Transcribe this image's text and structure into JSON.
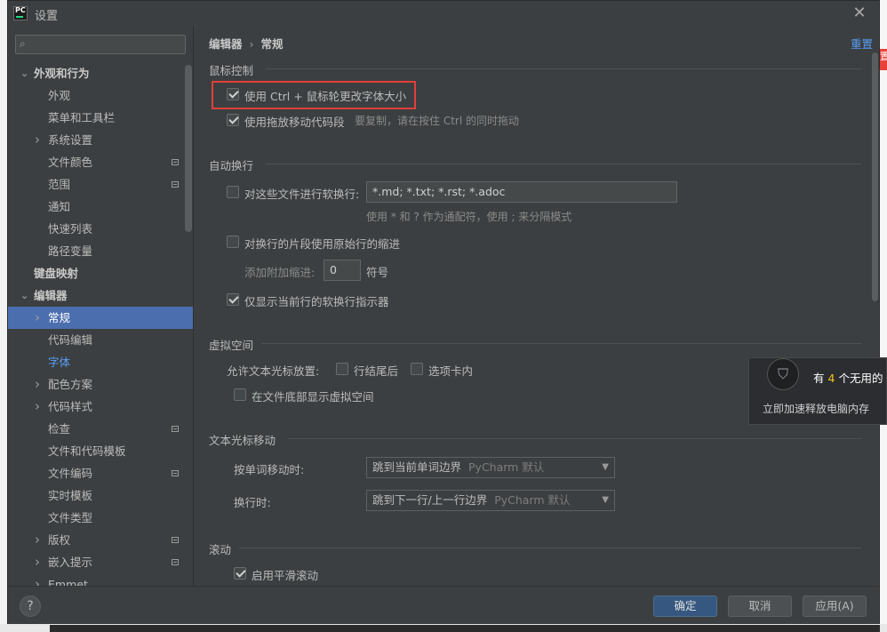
{
  "window": {
    "title": "设置",
    "app_icon": "PC"
  },
  "search": {
    "placeholder": ""
  },
  "sidebar": {
    "items": [
      {
        "label": "外观和行为",
        "level": 0,
        "bold": true,
        "arrow": "down"
      },
      {
        "label": "外观",
        "level": 1
      },
      {
        "label": "菜单和工具栏",
        "level": 1
      },
      {
        "label": "系统设置",
        "level": 1,
        "arrow": "right"
      },
      {
        "label": "文件颜色",
        "level": 1,
        "badge": true
      },
      {
        "label": "范围",
        "level": 1,
        "badge": true
      },
      {
        "label": "通知",
        "level": 1
      },
      {
        "label": "快速列表",
        "level": 1
      },
      {
        "label": "路径变量",
        "level": 1
      },
      {
        "label": "键盘映射",
        "level": 0,
        "bold": true
      },
      {
        "label": "编辑器",
        "level": 0,
        "bold": true,
        "arrow": "down"
      },
      {
        "label": "常规",
        "level": 1,
        "arrow": "right",
        "selected": true
      },
      {
        "label": "代码编辑",
        "level": 1
      },
      {
        "label": "字体",
        "level": 1,
        "link": true
      },
      {
        "label": "配色方案",
        "level": 1,
        "arrow": "right"
      },
      {
        "label": "代码样式",
        "level": 1,
        "arrow": "right"
      },
      {
        "label": "检查",
        "level": 1,
        "badge": true
      },
      {
        "label": "文件和代码模板",
        "level": 1
      },
      {
        "label": "文件编码",
        "level": 1,
        "badge": true
      },
      {
        "label": "实时模板",
        "level": 1
      },
      {
        "label": "文件类型",
        "level": 1
      },
      {
        "label": "版权",
        "level": 1,
        "arrow": "right",
        "badge": true
      },
      {
        "label": "嵌入提示",
        "level": 1,
        "arrow": "right",
        "badge": true
      },
      {
        "label": "Emmet",
        "level": 1,
        "arrow": "right"
      }
    ]
  },
  "breadcrumb": {
    "parent": "编辑器",
    "separator": "›",
    "current": "常规"
  },
  "reset_label": "重置",
  "sections": {
    "mouse": {
      "title": "鼠标控制",
      "ctrl_wheel_label": "使用 Ctrl + 鼠标轮更改字体大小",
      "ctrl_wheel_checked": true,
      "dnd_label": "使用拖放移动代码段",
      "dnd_checked": true,
      "dnd_hint": "要复制，请在按住 Ctrl 的同时拖动"
    },
    "softwrap": {
      "title": "自动换行",
      "files_label": "对这些文件进行软换行:",
      "files_checked": false,
      "files_value": "*.md; *.txt; *.rst; *.adoc",
      "files_hint": "使用 * 和 ? 作为通配符，使用 ; 来分隔模式",
      "indent_label": "对换行的片段使用原始行的缩进",
      "indent_checked": false,
      "extra_indent_label": "添加附加缩进:",
      "extra_indent_value": "0",
      "extra_indent_unit": "符号",
      "indicator_label": "仅显示当前行的软换行指示器",
      "indicator_checked": true
    },
    "virtual": {
      "title": "虚拟空间",
      "caret_label": "允许文本光标放置:",
      "line_end_label": "行结尾后",
      "line_end_checked": false,
      "tab_label": "选项卡内",
      "tab_checked": false,
      "bottom_label": "在文件底部显示虚拟空间",
      "bottom_checked": false
    },
    "caret": {
      "title": "文本光标移动",
      "word_label": "按单词移动时:",
      "word_value": "跳到当前单词边界",
      "word_sub": "PyCharm 默认",
      "line_label": "换行时:",
      "line_value": "跳到下一行/上一行边界",
      "line_sub": "PyCharm 默认"
    },
    "scroll": {
      "title": "滚动",
      "smooth_label": "启用平滑滚动",
      "smooth_checked": true
    }
  },
  "buttons": {
    "help": "?",
    "ok": "确定",
    "cancel": "取消",
    "apply": "应用(A)"
  },
  "popup": {
    "prefix": "有",
    "count": "4",
    "suffix": "个无用的",
    "sub": "立即加速释放电脑内存"
  },
  "outside": {
    "red_tab": "置"
  }
}
